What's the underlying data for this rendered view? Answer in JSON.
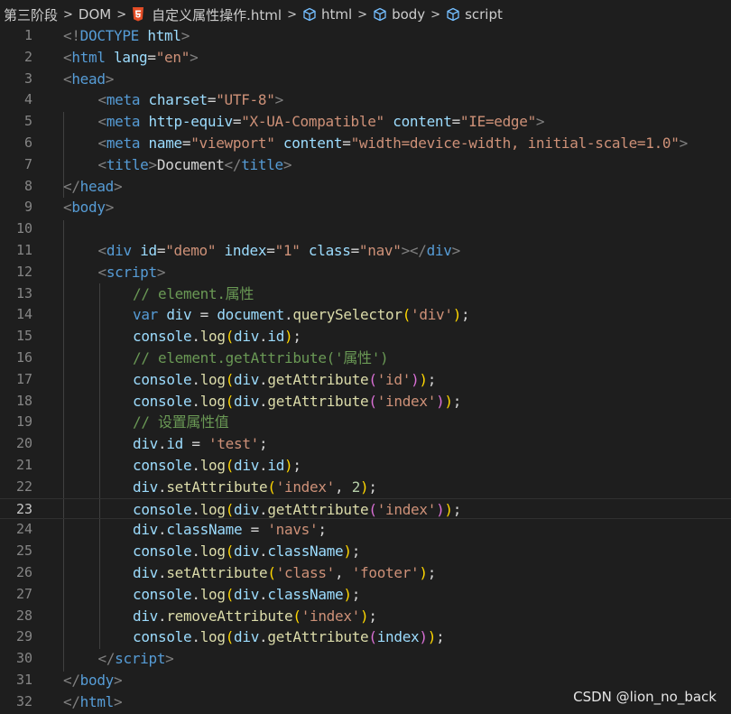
{
  "breadcrumb": {
    "items": [
      "第三阶段",
      "DOM",
      "自定义属性操作.html",
      "html",
      "body",
      "script"
    ],
    "separator": ">",
    "icons": [
      "",
      "",
      "html5-icon",
      "cube-icon",
      "cube-icon",
      "cube-icon"
    ]
  },
  "editor": {
    "current_line": 23,
    "lines": [
      {
        "n": 1,
        "tokens": [
          [
            "t-punct",
            "<!"
          ],
          [
            "t-tag",
            "DOCTYPE"
          ],
          [
            "t-text",
            " "
          ],
          [
            "t-attr",
            "html"
          ],
          [
            "t-punct",
            ">"
          ]
        ]
      },
      {
        "n": 2,
        "tokens": [
          [
            "t-punct",
            "<"
          ],
          [
            "t-tag",
            "html"
          ],
          [
            "t-text",
            " "
          ],
          [
            "t-attr",
            "lang"
          ],
          [
            "t-text",
            "="
          ],
          [
            "t-str",
            "\"en\""
          ],
          [
            "t-punct",
            ">"
          ]
        ]
      },
      {
        "n": 3,
        "tokens": [
          [
            "t-punct",
            "<"
          ],
          [
            "t-tag",
            "head"
          ],
          [
            "t-punct",
            ">"
          ]
        ]
      },
      {
        "n": 4,
        "indent": 1,
        "tokens": [
          [
            "t-punct",
            "<"
          ],
          [
            "t-tag",
            "meta"
          ],
          [
            "t-text",
            " "
          ],
          [
            "t-attr",
            "charset"
          ],
          [
            "t-text",
            "="
          ],
          [
            "t-str",
            "\"UTF-8\""
          ],
          [
            "t-punct",
            ">"
          ]
        ]
      },
      {
        "n": 5,
        "indent": 1,
        "tokens": [
          [
            "t-punct",
            "<"
          ],
          [
            "t-tag",
            "meta"
          ],
          [
            "t-text",
            " "
          ],
          [
            "t-attr",
            "http-equiv"
          ],
          [
            "t-text",
            "="
          ],
          [
            "t-str",
            "\"X-UA-Compatible\""
          ],
          [
            "t-text",
            " "
          ],
          [
            "t-attr",
            "content"
          ],
          [
            "t-text",
            "="
          ],
          [
            "t-str",
            "\"IE=edge\""
          ],
          [
            "t-punct",
            ">"
          ]
        ]
      },
      {
        "n": 6,
        "indent": 1,
        "tokens": [
          [
            "t-punct",
            "<"
          ],
          [
            "t-tag",
            "meta"
          ],
          [
            "t-text",
            " "
          ],
          [
            "t-attr",
            "name"
          ],
          [
            "t-text",
            "="
          ],
          [
            "t-str",
            "\"viewport\""
          ],
          [
            "t-text",
            " "
          ],
          [
            "t-attr",
            "content"
          ],
          [
            "t-text",
            "="
          ],
          [
            "t-str",
            "\"width=device-width, initial-scale=1.0\""
          ],
          [
            "t-punct",
            ">"
          ]
        ]
      },
      {
        "n": 7,
        "indent": 1,
        "tokens": [
          [
            "t-punct",
            "<"
          ],
          [
            "t-tag",
            "title"
          ],
          [
            "t-punct",
            ">"
          ],
          [
            "t-text",
            "Document"
          ],
          [
            "t-punct",
            "</"
          ],
          [
            "t-tag",
            "title"
          ],
          [
            "t-punct",
            ">"
          ]
        ]
      },
      {
        "n": 8,
        "tokens": [
          [
            "t-punct",
            "</"
          ],
          [
            "t-tag",
            "head"
          ],
          [
            "t-punct",
            ">"
          ]
        ]
      },
      {
        "n": 9,
        "tokens": [
          [
            "t-punct",
            "<"
          ],
          [
            "t-tag",
            "body"
          ],
          [
            "t-punct",
            ">"
          ]
        ]
      },
      {
        "n": 10,
        "tokens": []
      },
      {
        "n": 11,
        "indent": 1,
        "tokens": [
          [
            "t-punct",
            "<"
          ],
          [
            "t-tag",
            "div"
          ],
          [
            "t-text",
            " "
          ],
          [
            "t-attr",
            "id"
          ],
          [
            "t-text",
            "="
          ],
          [
            "t-str",
            "\"demo\""
          ],
          [
            "t-text",
            " "
          ],
          [
            "t-attr",
            "index"
          ],
          [
            "t-text",
            "="
          ],
          [
            "t-str",
            "\"1\""
          ],
          [
            "t-text",
            " "
          ],
          [
            "t-attr",
            "class"
          ],
          [
            "t-text",
            "="
          ],
          [
            "t-str",
            "\"nav\""
          ],
          [
            "t-punct",
            "></"
          ],
          [
            "t-tag",
            "div"
          ],
          [
            "t-punct",
            ">"
          ]
        ]
      },
      {
        "n": 12,
        "indent": 1,
        "tokens": [
          [
            "t-punct",
            "<"
          ],
          [
            "t-tag",
            "script"
          ],
          [
            "t-punct",
            ">"
          ]
        ]
      },
      {
        "n": 13,
        "indent": 2,
        "tokens": [
          [
            "t-comment",
            "// element.属性"
          ]
        ]
      },
      {
        "n": 14,
        "indent": 2,
        "tokens": [
          [
            "t-kw",
            "var"
          ],
          [
            "t-text",
            " "
          ],
          [
            "t-var",
            "div"
          ],
          [
            "t-op",
            " = "
          ],
          [
            "t-var",
            "document"
          ],
          [
            "t-text",
            "."
          ],
          [
            "t-fn",
            "querySelector"
          ],
          [
            "t-b1",
            "("
          ],
          [
            "t-str",
            "'div'"
          ],
          [
            "t-b1",
            ")"
          ],
          [
            "t-text",
            ";"
          ]
        ]
      },
      {
        "n": 15,
        "indent": 2,
        "tokens": [
          [
            "t-var",
            "console"
          ],
          [
            "t-text",
            "."
          ],
          [
            "t-fn",
            "log"
          ],
          [
            "t-b1",
            "("
          ],
          [
            "t-var",
            "div"
          ],
          [
            "t-text",
            "."
          ],
          [
            "t-var",
            "id"
          ],
          [
            "t-b1",
            ")"
          ],
          [
            "t-text",
            ";"
          ]
        ]
      },
      {
        "n": 16,
        "indent": 2,
        "tokens": [
          [
            "t-comment",
            "// element.getAttribute('属性')"
          ]
        ]
      },
      {
        "n": 17,
        "indent": 2,
        "tokens": [
          [
            "t-var",
            "console"
          ],
          [
            "t-text",
            "."
          ],
          [
            "t-fn",
            "log"
          ],
          [
            "t-b1",
            "("
          ],
          [
            "t-var",
            "div"
          ],
          [
            "t-text",
            "."
          ],
          [
            "t-fn",
            "getAttribute"
          ],
          [
            "t-b2",
            "("
          ],
          [
            "t-str",
            "'id'"
          ],
          [
            "t-b2",
            ")"
          ],
          [
            "t-b1",
            ")"
          ],
          [
            "t-text",
            ";"
          ]
        ]
      },
      {
        "n": 18,
        "indent": 2,
        "tokens": [
          [
            "t-var",
            "console"
          ],
          [
            "t-text",
            "."
          ],
          [
            "t-fn",
            "log"
          ],
          [
            "t-b1",
            "("
          ],
          [
            "t-var",
            "div"
          ],
          [
            "t-text",
            "."
          ],
          [
            "t-fn",
            "getAttribute"
          ],
          [
            "t-b2",
            "("
          ],
          [
            "t-str",
            "'index'"
          ],
          [
            "t-b2",
            ")"
          ],
          [
            "t-b1",
            ")"
          ],
          [
            "t-text",
            ";"
          ]
        ]
      },
      {
        "n": 19,
        "indent": 2,
        "tokens": [
          [
            "t-comment",
            "// 设置属性值"
          ]
        ]
      },
      {
        "n": 20,
        "indent": 2,
        "tokens": [
          [
            "t-var",
            "div"
          ],
          [
            "t-text",
            "."
          ],
          [
            "t-var",
            "id"
          ],
          [
            "t-op",
            " = "
          ],
          [
            "t-str",
            "'test'"
          ],
          [
            "t-text",
            ";"
          ]
        ]
      },
      {
        "n": 21,
        "indent": 2,
        "tokens": [
          [
            "t-var",
            "console"
          ],
          [
            "t-text",
            "."
          ],
          [
            "t-fn",
            "log"
          ],
          [
            "t-b1",
            "("
          ],
          [
            "t-var",
            "div"
          ],
          [
            "t-text",
            "."
          ],
          [
            "t-var",
            "id"
          ],
          [
            "t-b1",
            ")"
          ],
          [
            "t-text",
            ";"
          ]
        ]
      },
      {
        "n": 22,
        "indent": 2,
        "tokens": [
          [
            "t-var",
            "div"
          ],
          [
            "t-text",
            "."
          ],
          [
            "t-fn",
            "setAttribute"
          ],
          [
            "t-b1",
            "("
          ],
          [
            "t-str",
            "'index'"
          ],
          [
            "t-text",
            ", "
          ],
          [
            "t-num",
            "2"
          ],
          [
            "t-b1",
            ")"
          ],
          [
            "t-text",
            ";"
          ]
        ]
      },
      {
        "n": 23,
        "indent": 2,
        "tokens": [
          [
            "t-var",
            "console"
          ],
          [
            "t-text",
            "."
          ],
          [
            "t-fn",
            "log"
          ],
          [
            "t-b1",
            "("
          ],
          [
            "t-var",
            "div"
          ],
          [
            "t-text",
            "."
          ],
          [
            "t-fn",
            "getAttribute"
          ],
          [
            "t-b2",
            "("
          ],
          [
            "t-str",
            "'index'"
          ],
          [
            "t-b2",
            ")"
          ],
          [
            "t-b1",
            ")"
          ],
          [
            "t-text",
            ";"
          ]
        ]
      },
      {
        "n": 24,
        "indent": 2,
        "tokens": [
          [
            "t-var",
            "div"
          ],
          [
            "t-text",
            "."
          ],
          [
            "t-var",
            "className"
          ],
          [
            "t-op",
            " = "
          ],
          [
            "t-str",
            "'navs'"
          ],
          [
            "t-text",
            ";"
          ]
        ]
      },
      {
        "n": 25,
        "indent": 2,
        "tokens": [
          [
            "t-var",
            "console"
          ],
          [
            "t-text",
            "."
          ],
          [
            "t-fn",
            "log"
          ],
          [
            "t-b1",
            "("
          ],
          [
            "t-var",
            "div"
          ],
          [
            "t-text",
            "."
          ],
          [
            "t-var",
            "className"
          ],
          [
            "t-b1",
            ")"
          ],
          [
            "t-text",
            ";"
          ]
        ]
      },
      {
        "n": 26,
        "indent": 2,
        "tokens": [
          [
            "t-var",
            "div"
          ],
          [
            "t-text",
            "."
          ],
          [
            "t-fn",
            "setAttribute"
          ],
          [
            "t-b1",
            "("
          ],
          [
            "t-str",
            "'class'"
          ],
          [
            "t-text",
            ", "
          ],
          [
            "t-str",
            "'footer'"
          ],
          [
            "t-b1",
            ")"
          ],
          [
            "t-text",
            ";"
          ]
        ]
      },
      {
        "n": 27,
        "indent": 2,
        "tokens": [
          [
            "t-var",
            "console"
          ],
          [
            "t-text",
            "."
          ],
          [
            "t-fn",
            "log"
          ],
          [
            "t-b1",
            "("
          ],
          [
            "t-var",
            "div"
          ],
          [
            "t-text",
            "."
          ],
          [
            "t-var",
            "className"
          ],
          [
            "t-b1",
            ")"
          ],
          [
            "t-text",
            ";"
          ]
        ]
      },
      {
        "n": 28,
        "indent": 2,
        "tokens": [
          [
            "t-var",
            "div"
          ],
          [
            "t-text",
            "."
          ],
          [
            "t-fn",
            "removeAttribute"
          ],
          [
            "t-b1",
            "("
          ],
          [
            "t-str",
            "'index'"
          ],
          [
            "t-b1",
            ")"
          ],
          [
            "t-text",
            ";"
          ]
        ]
      },
      {
        "n": 29,
        "indent": 2,
        "tokens": [
          [
            "t-var",
            "console"
          ],
          [
            "t-text",
            "."
          ],
          [
            "t-fn",
            "log"
          ],
          [
            "t-b1",
            "("
          ],
          [
            "t-var",
            "div"
          ],
          [
            "t-text",
            "."
          ],
          [
            "t-fn",
            "getAttribute"
          ],
          [
            "t-b2",
            "("
          ],
          [
            "t-var",
            "index"
          ],
          [
            "t-b2",
            ")"
          ],
          [
            "t-b1",
            ")"
          ],
          [
            "t-text",
            ";"
          ]
        ]
      },
      {
        "n": 30,
        "indent": 1,
        "tokens": [
          [
            "t-punct",
            "</"
          ],
          [
            "t-tag",
            "script"
          ],
          [
            "t-punct",
            ">"
          ]
        ]
      },
      {
        "n": 31,
        "tokens": [
          [
            "t-punct",
            "</"
          ],
          [
            "t-tag",
            "body"
          ],
          [
            "t-punct",
            ">"
          ]
        ]
      },
      {
        "n": 32,
        "tokens": [
          [
            "t-punct",
            "</"
          ],
          [
            "t-tag",
            "html"
          ],
          [
            "t-punct",
            ">"
          ]
        ]
      }
    ]
  },
  "watermark": "CSDN @lion_no_back",
  "colors": {
    "background": "#1e1e1e",
    "tag": "#569cd6",
    "attribute": "#9cdcfe",
    "string": "#ce9178",
    "comment": "#6a9955",
    "function": "#dcdcaa",
    "number": "#b5cea8",
    "bracket_1": "#ffd700",
    "bracket_2": "#da70d6"
  }
}
